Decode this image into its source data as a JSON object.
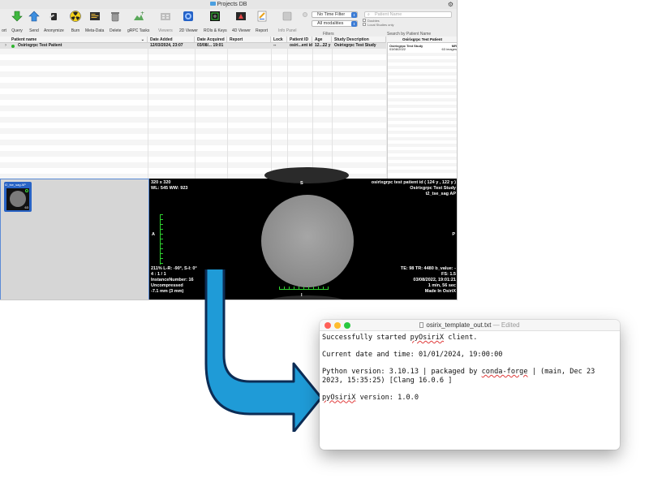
{
  "window": {
    "title": "Projects DB"
  },
  "toolbar": {
    "items": [
      {
        "label": "ort",
        "icon": "import-icon"
      },
      {
        "label": "Query",
        "icon": "query-download-icon"
      },
      {
        "label": "Send",
        "icon": "send-upload-icon"
      },
      {
        "label": "Anonymize",
        "icon": "anonymize-icon"
      },
      {
        "label": "Burn",
        "icon": "burn-radiation-icon"
      },
      {
        "label": "Meta-Data",
        "icon": "metadata-icon"
      },
      {
        "label": "Delete",
        "icon": "trash-icon"
      },
      {
        "label": "gRPC Tasks",
        "icon": "grpc-tasks-icon"
      },
      {
        "label": "Viewers",
        "icon": "viewers-icon"
      },
      {
        "label": "2D Viewer",
        "icon": "2d-viewer-icon"
      },
      {
        "label": "ROIs & Keys",
        "icon": "rois-keys-icon"
      },
      {
        "label": "4D Viewer",
        "icon": "4d-viewer-icon"
      },
      {
        "label": "Report",
        "icon": "report-icon"
      },
      {
        "label": "Info Panel",
        "icon": "info-panel-icon"
      }
    ],
    "time_filter": "No Time Filter",
    "modality_filter": "All modalities",
    "filters_label": "Filters",
    "search_placeholder": "Patient Name",
    "search_label": "Search by Patient Name",
    "check1": "Doubles",
    "check2": "Local Studies only"
  },
  "table": {
    "headers": [
      "Patient name",
      "Date Added",
      "Date Acquired",
      "Report",
      "Lock",
      "Patient ID",
      "Age",
      "Study Description"
    ],
    "rows": [
      [
        "Osirixgrpc Test Patient",
        "12/03/2024, 23:07",
        "03/08/... 19:01",
        "",
        "--",
        "osiri...ent id",
        "12...22 y",
        "Osirixgrpc Test Study"
      ]
    ]
  },
  "side_panel": {
    "header": "Osirixgrpc Test Patient",
    "series_name": "Osirixgrpc Test Study",
    "series_date": "03/08/2022",
    "series_modality": "MR",
    "series_count": "63 images"
  },
  "thumbnail": {
    "label": "t2_tse_sag AP",
    "count": "63"
  },
  "viewer": {
    "top_left": [
      "320 x 320",
      "WL: 545 WW: 923"
    ],
    "top_right": [
      "osirixgrpc test patient id ( 124 y , 122 y )",
      "Osirixgrpc Test Study",
      "t2_tse_sag AP"
    ],
    "bottom_left": [
      "211% L-R: -90°, S-I: 0°",
      "4 : 1 / 1",
      "InstanceNumber: 16",
      "Uncompressed",
      "-7.1 mm (3 mm)"
    ],
    "bottom_right": [
      "TE: 98 TR: 4480 b_value: -",
      "FS: 1.5",
      "03/08/2022, 19:01:21",
      "1 min, 56 sec",
      "Made In OsiriX"
    ],
    "orient_top": "S",
    "orient_left": "A",
    "orient_right": "P",
    "orient_bottom": "I"
  },
  "colors": {
    "arrow": "#1f9bd7",
    "arrow_outline": "#0c2c55",
    "selection": "#2863c5"
  },
  "editor": {
    "filename": "osirix_template_out.txt",
    "status": "— Edited",
    "lines": [
      "Successfully started pyOsiriX client.",
      "",
      "Current date and time: 01/01/2024, 19:00:00",
      "",
      "Python version: 3.10.13 | packaged by conda-forge | (main, Dec 23 2023, 15:35:25) [Clang 16.0.6 ]",
      "",
      "pyOsiriX version: 1.0.0"
    ]
  }
}
